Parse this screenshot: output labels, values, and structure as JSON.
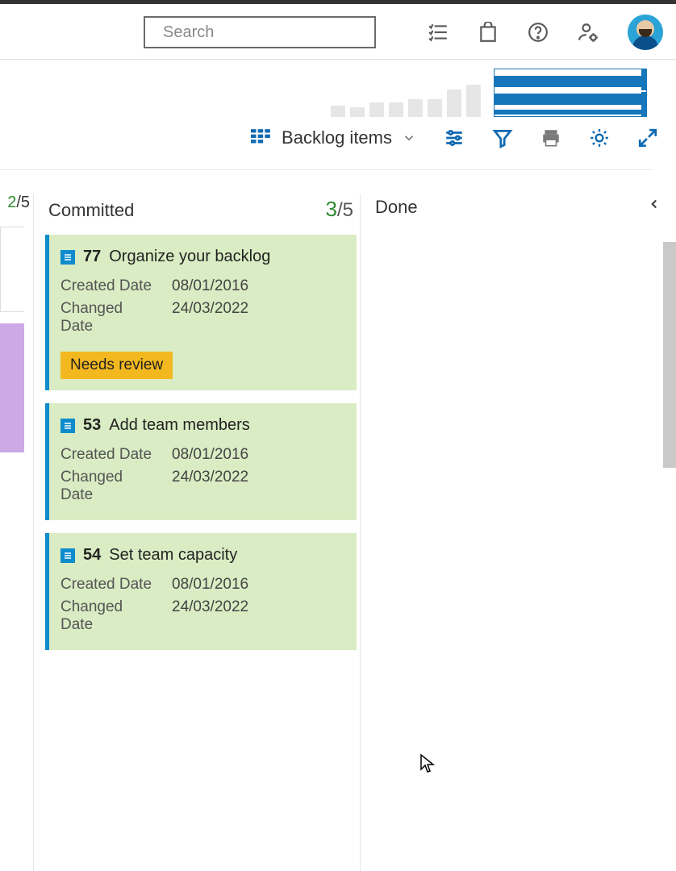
{
  "search": {
    "placeholder": "Search"
  },
  "view_selector": {
    "label": "Backlog items"
  },
  "columns": {
    "prev": {
      "count_num": "2",
      "count_den": "/5"
    },
    "committed": {
      "title": "Committed",
      "count_num": "3",
      "count_den": "/5"
    },
    "done": {
      "title": "Done"
    }
  },
  "cards": [
    {
      "id": "77",
      "title": "Organize your backlog",
      "created_label": "Created Date",
      "created": "08/01/2016",
      "changed_label": "Changed Date",
      "changed": "24/03/2022",
      "tag": "Needs review"
    },
    {
      "id": "53",
      "title": "Add team members",
      "created_label": "Created Date",
      "created": "08/01/2016",
      "changed_label": "Changed Date",
      "changed": "24/03/2022"
    },
    {
      "id": "54",
      "title": "Set team capacity",
      "created_label": "Created Date",
      "created": "08/01/2016",
      "changed_label": "Changed Date",
      "changed": "24/03/2022"
    }
  ],
  "chart_data": {
    "type": "bar",
    "categories": [
      "b1",
      "b2",
      "b3",
      "b4",
      "b5",
      "b6",
      "b7",
      "b8"
    ],
    "values": [
      14,
      12,
      18,
      18,
      22,
      22,
      34,
      40
    ],
    "title": "",
    "xlabel": "",
    "ylabel": "",
    "ylim": [
      0,
      60
    ]
  }
}
